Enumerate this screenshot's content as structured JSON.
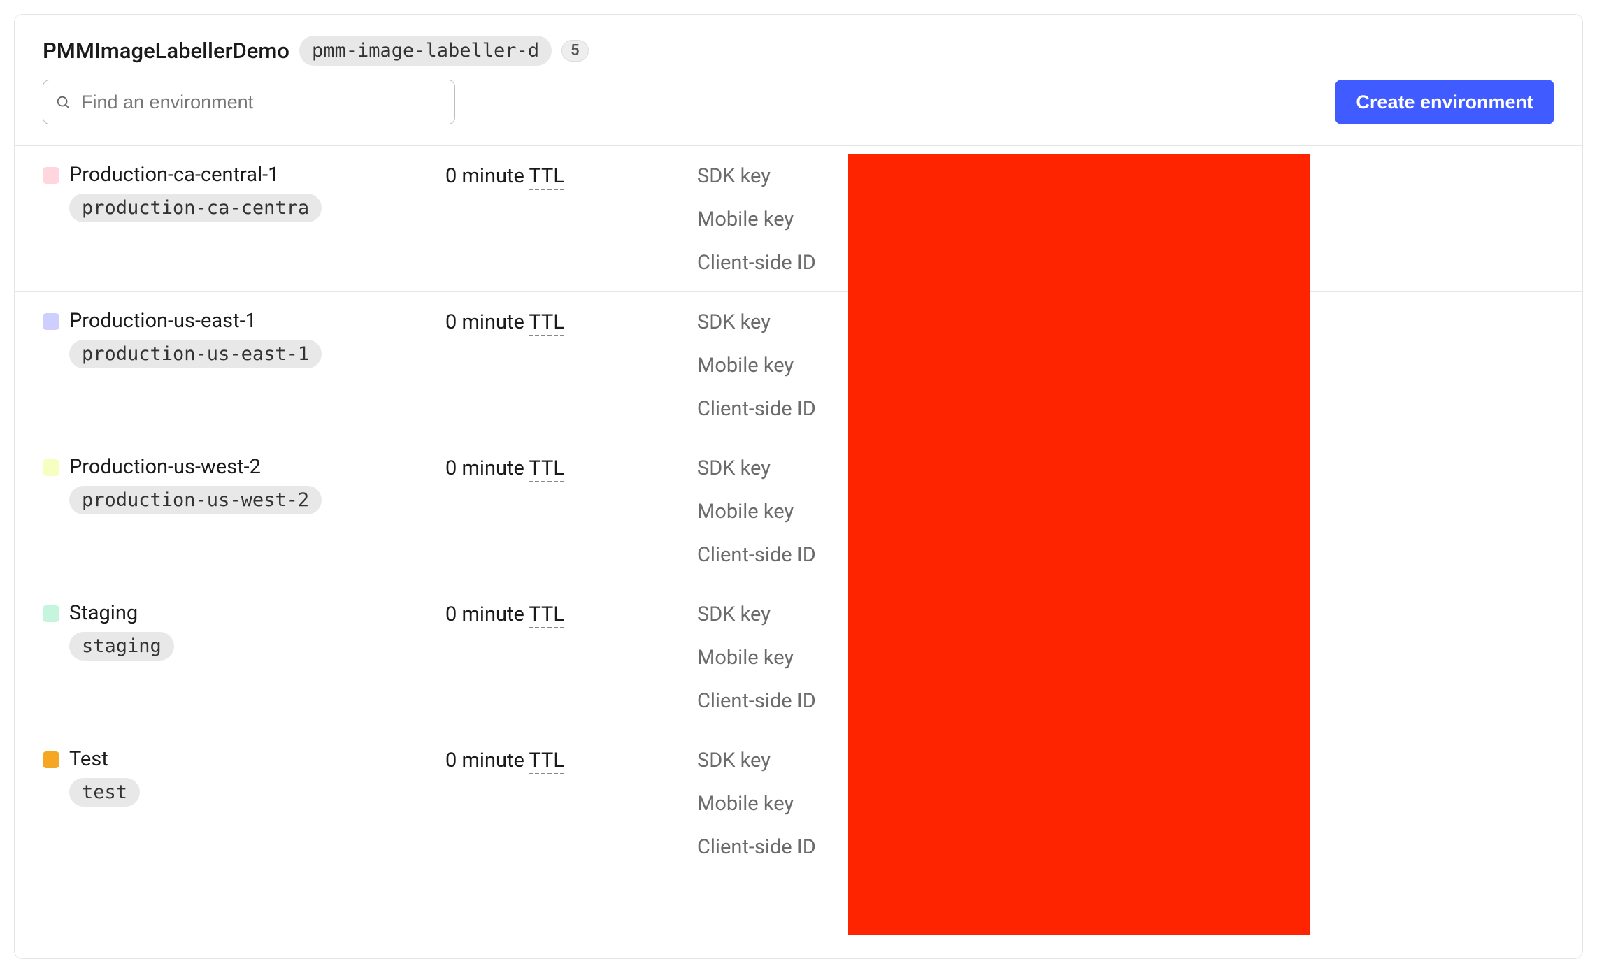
{
  "header": {
    "project_title": "PMMImageLabellerDemo",
    "project_slug": "pmm-image-labeller-d",
    "env_count": "5",
    "search_placeholder": "Find an environment",
    "create_button": "Create environment"
  },
  "key_labels": {
    "sdk": "SDK key",
    "mobile": "Mobile key",
    "client": "Client-side ID"
  },
  "ttl_prefix": "0 minute ",
  "ttl_abbr": "TTL",
  "environments": [
    {
      "name": "Production-ca-central-1",
      "key": "production-ca-centra",
      "color": "#ffd6de"
    },
    {
      "name": "Production-us-east-1",
      "key": "production-us-east-1",
      "color": "#cfcfff"
    },
    {
      "name": "Production-us-west-2",
      "key": "production-us-west-2",
      "color": "#f6ffbf"
    },
    {
      "name": "Staging",
      "key": "staging",
      "color": "#c5f5dc"
    },
    {
      "name": "Test",
      "key": "test",
      "color": "#f5a623"
    }
  ]
}
